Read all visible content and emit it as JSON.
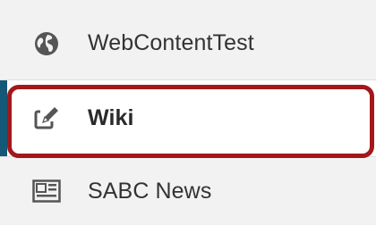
{
  "nav": {
    "items": [
      {
        "label": "WebContentTest",
        "icon": "globe-icon",
        "active": false
      },
      {
        "label": "Wiki",
        "icon": "edit-icon",
        "active": true
      },
      {
        "label": "SABC News",
        "icon": "newspaper-icon",
        "active": false
      }
    ]
  },
  "colors": {
    "panel_background": "#f2f2f2",
    "active_background": "#ffffff",
    "active_indicator": "#155776",
    "highlight_border": "#a3171b",
    "text": "#333333",
    "icon": "#555555"
  }
}
